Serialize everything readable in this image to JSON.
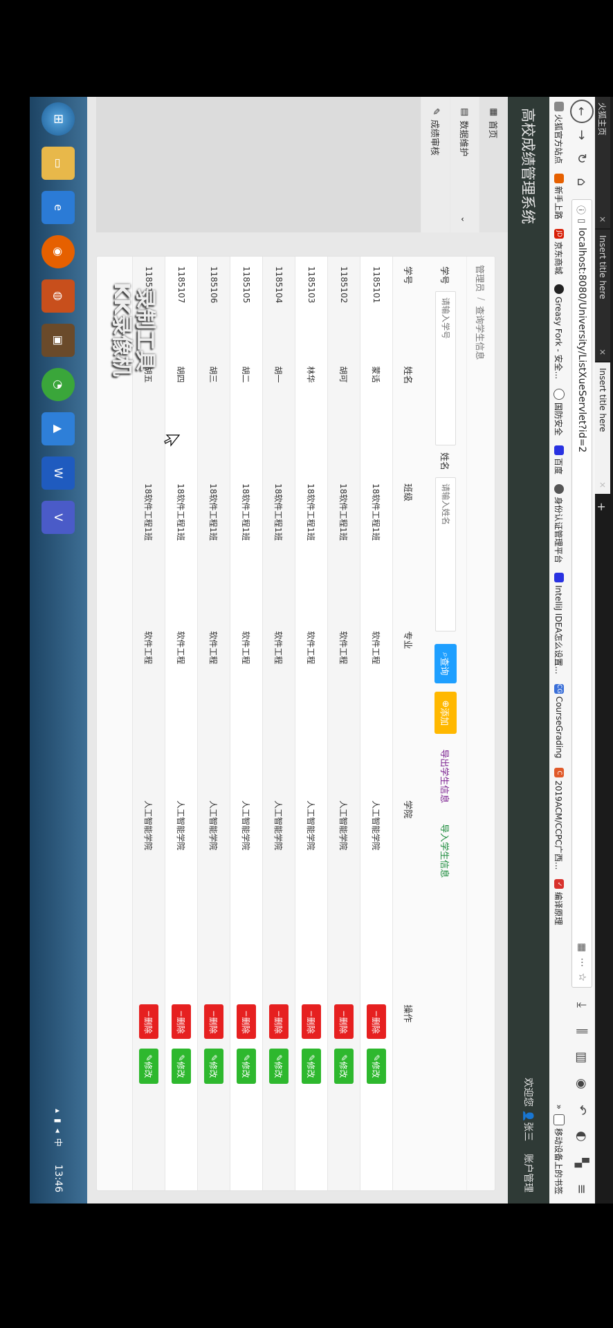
{
  "browser": {
    "tabs": [
      {
        "title": "火狐主页",
        "close": "×"
      },
      {
        "title": "Insert title here",
        "close": "×"
      },
      {
        "title": "Insert title here",
        "close": "×"
      }
    ],
    "new_tab": "+",
    "url": "localhost:8080/University/ListXueServlet?id=2",
    "bookmarks": [
      "火狐官方站点",
      "新手上路",
      "京东商城",
      "Greasy Fork - 安全...",
      "国防安全",
      "百度",
      "身份认证管理平台",
      "IntelliJ IDEA怎么设置...",
      "CourseGrading",
      "2019ACM/CCPC广西...",
      "编译原理"
    ],
    "bookmarks_more": "»",
    "mobile_bookmarks": "移动设备上的书签"
  },
  "app": {
    "title": "高校成绩管理系统",
    "welcome": "欢迎您",
    "user": "张三",
    "account": "账户管理"
  },
  "sidebar": {
    "items": [
      {
        "label": "首页",
        "icon": "grid-icon"
      },
      {
        "label": "数据维护",
        "icon": "table-icon"
      },
      {
        "label": "成绩审核",
        "icon": "edit-icon"
      }
    ]
  },
  "main": {
    "breadcrumb": [
      "管理员",
      "查询学生信息"
    ],
    "search": {
      "id_label": "学号",
      "id_placeholder": "请输入学号",
      "name_label": "姓名",
      "name_placeholder": "请输入姓名",
      "search_btn": "查询",
      "add_btn": "添加",
      "export_link": "导出学生信息",
      "import_link": "导入学生信息"
    },
    "table": {
      "headers": [
        "学号",
        "姓名",
        "班级",
        "专业",
        "学院",
        "操作"
      ],
      "rows": [
        {
          "id": "1185101",
          "name": "蒙话",
          "class": "18软件工程1班",
          "major": "软件工程",
          "college": "人工智能学院"
        },
        {
          "id": "1185102",
          "name": "胡可",
          "class": "18软件工程1班",
          "major": "软件工程",
          "college": "人工智能学院"
        },
        {
          "id": "1185103",
          "name": "林华",
          "class": "18软件工程1班",
          "major": "软件工程",
          "college": "人工智能学院"
        },
        {
          "id": "1185104",
          "name": "胡一",
          "class": "18软件工程1班",
          "major": "软件工程",
          "college": "人工智能学院"
        },
        {
          "id": "1185105",
          "name": "胡二",
          "class": "18软件工程1班",
          "major": "软件工程",
          "college": "人工智能学院"
        },
        {
          "id": "1185106",
          "name": "胡三",
          "class": "18软件工程1班",
          "major": "软件工程",
          "college": "人工智能学院"
        },
        {
          "id": "1185107",
          "name": "胡四",
          "class": "18软件工程1班",
          "major": "软件工程",
          "college": "人工智能学院"
        },
        {
          "id": "1185108",
          "name": "胡五",
          "class": "18软件工程1班",
          "major": "软件工程",
          "college": "人工智能学院"
        }
      ],
      "delete_label": "删除",
      "edit_label": "修改"
    }
  },
  "watermark": [
    "录制工具",
    "KK录像机"
  ],
  "taskbar": {
    "clock": "13:46"
  },
  "colors": {
    "header_bg": "#2f3a36",
    "search_btn": "#1e9fff",
    "add_btn": "#ffb800",
    "delete_btn": "#e62020",
    "edit_btn": "#2eb82e",
    "export_link": "#7a1f8f",
    "import_link": "#1a8a3a"
  }
}
